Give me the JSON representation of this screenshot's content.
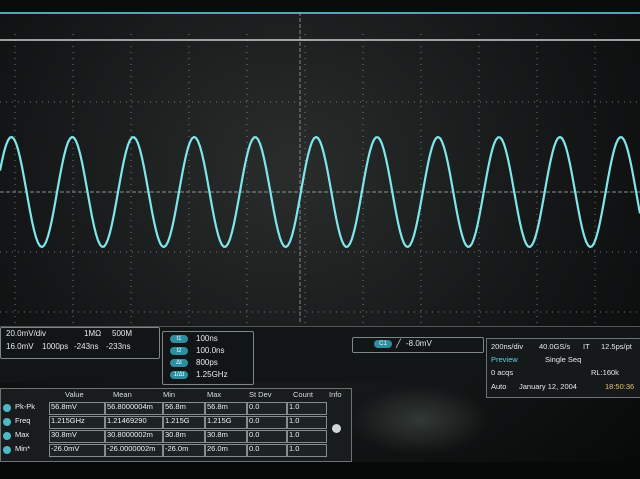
{
  "channel": {
    "scale": "20.0mV/div",
    "impedance": "1MΩ",
    "bandwidth": "500M",
    "offset": "16.0mV",
    "delay_a": "1000ps",
    "delay_b": "-243ns",
    "delay_c": "-233ns"
  },
  "cursors": {
    "t1": "100ns",
    "t2": "100.0ns",
    "dt": "800ps",
    "freq": "1.25GHz",
    "labels": [
      "t1",
      "t2",
      "Δt",
      "1/Δt"
    ]
  },
  "trigger": {
    "source": "C1",
    "level": "-8.0mV"
  },
  "acquisition": {
    "timebase": "200ns/div",
    "sample_rate": "40.0GS/s",
    "mode_short": "IT",
    "resolution": "12.5ps/pt",
    "preview_label": "Preview",
    "seq_mode": "Single Seq",
    "acqs": "0 acqs",
    "record_length": "RL:160k",
    "auto_label": "Auto",
    "date": "January 12, 2004",
    "time": "18:50:36"
  },
  "measurements": {
    "headers": [
      "Value",
      "Mean",
      "Min",
      "Max",
      "St Dev",
      "Count",
      "Info"
    ],
    "rows": [
      {
        "name": "Pk-Pk",
        "value": "56.8mV",
        "mean": "56.8000004m",
        "min": "56.8m",
        "max": "56.8m",
        "stdev": "0.0",
        "count": "1.0"
      },
      {
        "name": "Freq",
        "value": "1.215GHz",
        "mean": "1.21469290",
        "min": "1.215G",
        "max": "1.215G",
        "stdev": "0.0",
        "count": "1.0"
      },
      {
        "name": "Max",
        "value": "30.8mV",
        "mean": "30.8000002m",
        "min": "30.8m",
        "max": "30.8m",
        "stdev": "0.0",
        "count": "1.0"
      },
      {
        "name": "Min*",
        "value": "-26.0mV",
        "mean": "-26.0000002m",
        "min": "-26.0m",
        "max": "26.0m",
        "stdev": "0.0",
        "count": "1.0"
      }
    ]
  },
  "waveform": {
    "color": "#7fe6ec",
    "grid_color": "#9aa3a3",
    "accent": "#2e8ea0",
    "amplitude": 0.55,
    "cycles": 10.5
  }
}
